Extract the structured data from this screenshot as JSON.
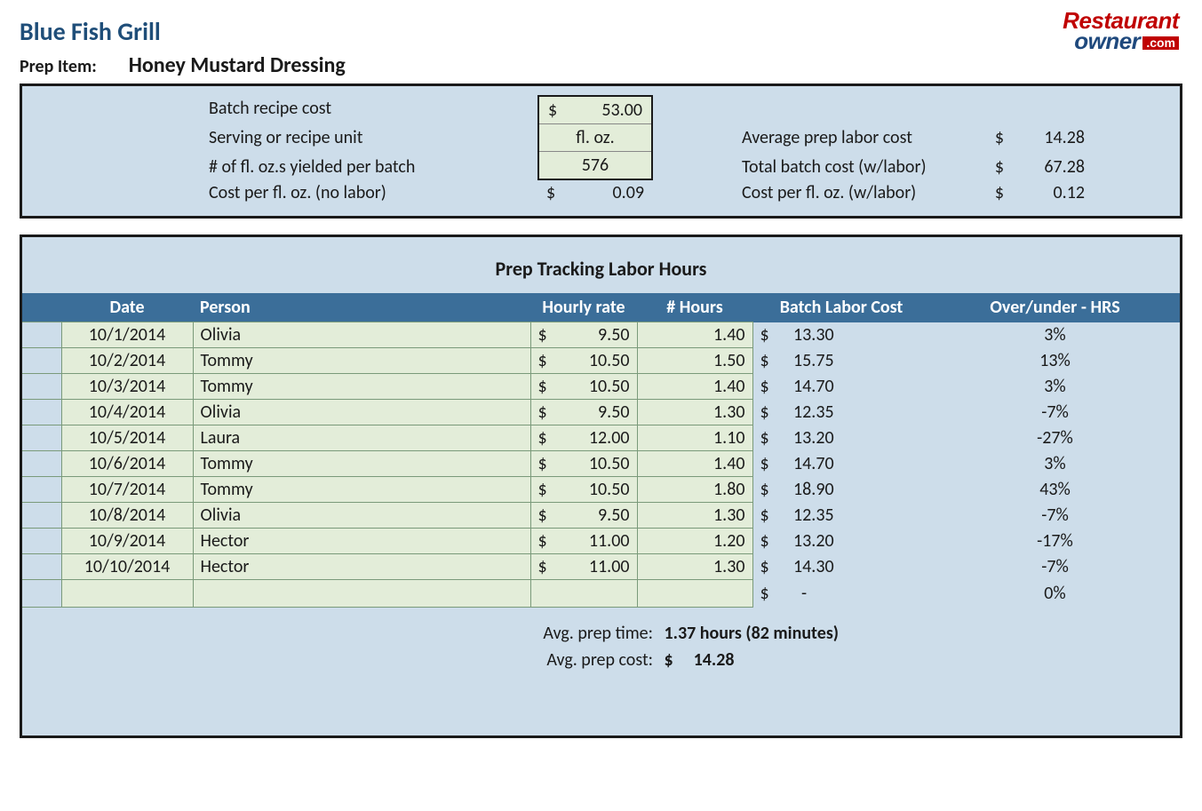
{
  "header": {
    "restaurant_name": "Blue Fish Grill",
    "prep_item_label": "Prep Item:",
    "prep_item_value": "Honey Mustard Dressing",
    "logo_line1": "Restaurant",
    "logo_line2": "owner",
    "logo_com": ".com"
  },
  "summary": {
    "batch_recipe_cost_label": "Batch recipe cost",
    "batch_recipe_cost_value": "53.00",
    "serving_unit_label": "Serving or recipe unit",
    "serving_unit_value": "fl. oz.",
    "yield_label": "# of fl. oz.s yielded per batch",
    "yield_value": "576",
    "cost_per_unit_nolabor_label": "Cost per fl. oz. (no labor)",
    "cost_per_unit_nolabor_value": "0.09",
    "avg_labor_label": "Average prep labor cost",
    "avg_labor_value": "14.28",
    "total_batch_label": "Total batch cost (w/labor)",
    "total_batch_value": "67.28",
    "cost_per_unit_wlabor_label": "Cost per fl. oz. (w/labor)",
    "cost_per_unit_wlabor_value": "0.12",
    "dollar": "$"
  },
  "labor_table": {
    "title": "Prep Tracking Labor Hours",
    "headers": {
      "date": "Date",
      "person": "Person",
      "rate": "Hourly rate",
      "hours": "# Hours",
      "batch_cost": "Batch Labor Cost",
      "over_under": "Over/under - HRS"
    },
    "rows": [
      {
        "date": "10/1/2014",
        "person": "Olivia",
        "rate": "9.50",
        "hours": "1.40",
        "batch_cost": "13.30",
        "over_under": "3%"
      },
      {
        "date": "10/2/2014",
        "person": "Tommy",
        "rate": "10.50",
        "hours": "1.50",
        "batch_cost": "15.75",
        "over_under": "13%"
      },
      {
        "date": "10/3/2014",
        "person": "Tommy",
        "rate": "10.50",
        "hours": "1.40",
        "batch_cost": "14.70",
        "over_under": "3%"
      },
      {
        "date": "10/4/2014",
        "person": "Olivia",
        "rate": "9.50",
        "hours": "1.30",
        "batch_cost": "12.35",
        "over_under": "-7%"
      },
      {
        "date": "10/5/2014",
        "person": "Laura",
        "rate": "12.00",
        "hours": "1.10",
        "batch_cost": "13.20",
        "over_under": "-27%"
      },
      {
        "date": "10/6/2014",
        "person": "Tommy",
        "rate": "10.50",
        "hours": "1.40",
        "batch_cost": "14.70",
        "over_under": "3%"
      },
      {
        "date": "10/7/2014",
        "person": "Tommy",
        "rate": "10.50",
        "hours": "1.80",
        "batch_cost": "18.90",
        "over_under": "43%"
      },
      {
        "date": "10/8/2014",
        "person": "Olivia",
        "rate": "9.50",
        "hours": "1.30",
        "batch_cost": "12.35",
        "over_under": "-7%"
      },
      {
        "date": "10/9/2014",
        "person": "Hector",
        "rate": "11.00",
        "hours": "1.20",
        "batch_cost": "13.20",
        "over_under": "-17%"
      },
      {
        "date": "10/10/2014",
        "person": "Hector",
        "rate": "11.00",
        "hours": "1.30",
        "batch_cost": "14.30",
        "over_under": "-7%"
      }
    ],
    "empty_row": {
      "batch_cost": "-",
      "over_under": "0%"
    },
    "avg_time_label": "Avg. prep time:",
    "avg_time_value": "1.37 hours (82 minutes)",
    "avg_cost_label": "Avg. prep cost:",
    "avg_cost_value": "14.28"
  }
}
